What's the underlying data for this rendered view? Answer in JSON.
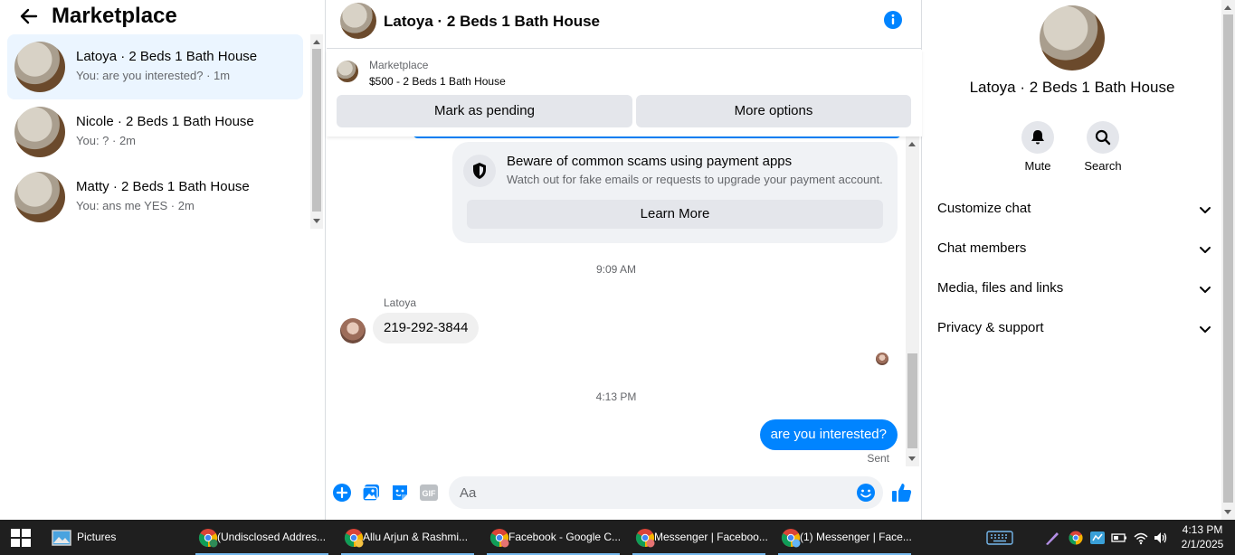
{
  "left": {
    "title": "Marketplace",
    "conversations": [
      {
        "name": "Latoya · 2 Beds 1 Bath House",
        "preview": "You: are you interested? · 1m"
      },
      {
        "name": "Nicole · 2 Beds 1 Bath House",
        "preview": "You: ? · 2m"
      },
      {
        "name": "Matty · 2 Beds 1 Bath House",
        "preview": "You: ans me YES · 2m"
      }
    ]
  },
  "chat": {
    "title": "Latoya · 2 Beds 1 Bath House",
    "listing": {
      "kicker": "Marketplace",
      "title": "$500 - 2 Beds 1 Bath House",
      "pending_label": "Mark as pending",
      "more_label": "More options"
    },
    "scam_card": {
      "title": "Beware of common scams using payment apps",
      "subtitle": "Watch out for fake emails or requests to upgrade your payment account.",
      "button": "Learn More"
    },
    "timestamp_1": "9:09 AM",
    "sender_name": "Latoya",
    "incoming_message": "219-292-3844",
    "timestamp_2": "4:13 PM",
    "outgoing_message": "are you interested?",
    "sent_status": "Sent",
    "composer": {
      "placeholder": "Aa",
      "gif_label": "GIF"
    }
  },
  "info_panel": {
    "title": "Latoya · 2 Beds 1 Bath House",
    "actions": [
      {
        "label": "Mute"
      },
      {
        "label": "Search"
      }
    ],
    "sections": [
      {
        "label": "Customize chat"
      },
      {
        "label": "Chat members"
      },
      {
        "label": "Media, files and links"
      },
      {
        "label": "Privacy & support"
      }
    ]
  },
  "taskbar": {
    "items": [
      {
        "label": "Pictures"
      },
      {
        "label": "(Undisclosed Addres..."
      },
      {
        "label": "Allu Arjun & Rashmi..."
      },
      {
        "label": "Facebook - Google C..."
      },
      {
        "label": "Messenger | Faceboo..."
      },
      {
        "label": "(1) Messenger | Face..."
      }
    ],
    "time": "4:13 PM",
    "date": "2/1/2025"
  },
  "colors": {
    "accent": "#0084ff",
    "active_row": "#ebf5ff",
    "button_gray": "#e4e6eb",
    "taskbar": "#1f1f1f"
  }
}
